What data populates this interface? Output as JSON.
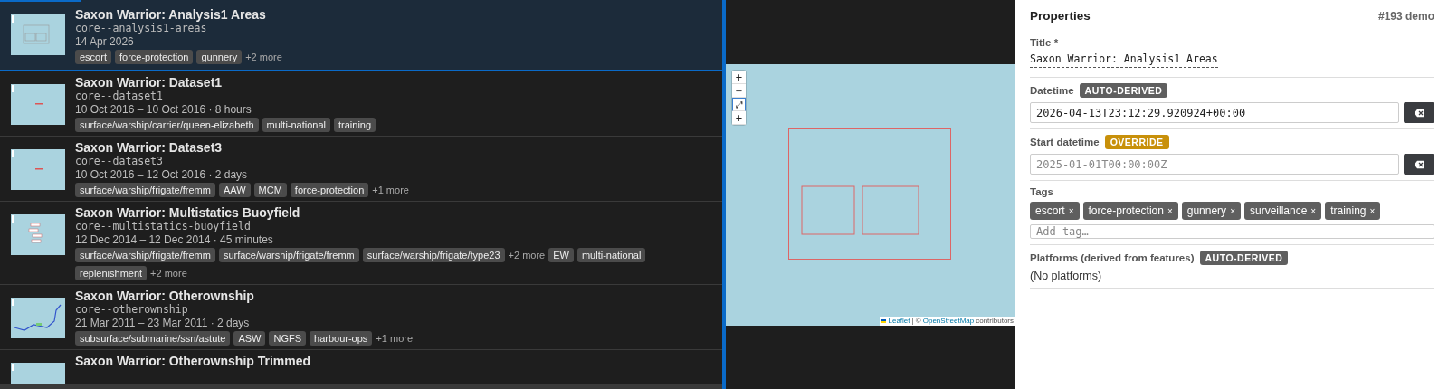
{
  "datasets": [
    {
      "title": "Saxon Warrior: Analysis1 Areas",
      "slug": "core--analysis1-areas",
      "date": "14 Apr 2026",
      "selected": true,
      "tags": [
        {
          "kind": "tag",
          "label": "escort"
        },
        {
          "kind": "tag",
          "label": "force-protection"
        },
        {
          "kind": "tag",
          "label": "gunnery"
        },
        {
          "kind": "more",
          "label": "+2 more"
        }
      ]
    },
    {
      "title": "Saxon Warrior: Dataset1",
      "slug": "core--dataset1",
      "date": "10 Oct 2016 – 10 Oct 2016 · 8 hours",
      "selected": false,
      "tags": [
        {
          "kind": "tag",
          "label": "surface/warship/carrier/queen-elizabeth"
        },
        {
          "kind": "tag",
          "label": "multi-national"
        },
        {
          "kind": "tag",
          "label": "training"
        }
      ]
    },
    {
      "title": "Saxon Warrior: Dataset3",
      "slug": "core--dataset3",
      "date": "10 Oct 2016 – 12 Oct 2016 · 2 days",
      "selected": false,
      "tags": [
        {
          "kind": "tag",
          "label": "surface/warship/frigate/fremm"
        },
        {
          "kind": "tag",
          "label": "AAW"
        },
        {
          "kind": "tag",
          "label": "MCM"
        },
        {
          "kind": "tag",
          "label": "force-protection"
        },
        {
          "kind": "more",
          "label": "+1 more"
        }
      ]
    },
    {
      "title": "Saxon Warrior: Multistatics Buoyfield",
      "slug": "core--multistatics-buoyfield",
      "date": "12 Dec 2014 – 12 Dec 2014 · 45 minutes",
      "selected": false,
      "tags": [
        {
          "kind": "tag",
          "label": "surface/warship/frigate/fremm"
        },
        {
          "kind": "tag",
          "label": "surface/warship/frigate/fremm"
        },
        {
          "kind": "tag",
          "label": "surface/warship/frigate/type23"
        },
        {
          "kind": "more",
          "label": "+2 more"
        },
        {
          "kind": "tag",
          "label": "EW"
        },
        {
          "kind": "tag",
          "label": "multi-national"
        },
        {
          "kind": "tag",
          "label": "replenishment"
        },
        {
          "kind": "more",
          "label": "+2 more"
        }
      ]
    },
    {
      "title": "Saxon Warrior: Otherownship",
      "slug": "core--otherownship",
      "date": "21 Mar 2011 – 23 Mar 2011 · 2 days",
      "selected": false,
      "tags": [
        {
          "kind": "tag",
          "label": "subsurface/submarine/ssn/astute"
        },
        {
          "kind": "tag",
          "label": "ASW"
        },
        {
          "kind": "tag",
          "label": "NGFS"
        },
        {
          "kind": "tag",
          "label": "harbour-ops"
        },
        {
          "kind": "more",
          "label": "+1 more"
        }
      ]
    },
    {
      "title": "Saxon Warrior: Otherownship Trimmed",
      "selected": false
    }
  ],
  "map": {
    "controls": [
      "+",
      "−",
      "⤢",
      "+"
    ],
    "attribution": {
      "link1": "Leaflet",
      "separator": "| ©",
      "link2": "OpenStreetMap",
      "rest": "contributors"
    }
  },
  "properties": {
    "heading": "Properties",
    "id": "#193 demo",
    "title_field": {
      "label": "Title *",
      "value": "Saxon Warrior: Analysis1 Areas"
    },
    "fields": [
      {
        "label": "Datetime",
        "badge": {
          "kind": "auto",
          "text": "AUTO-DERIVED"
        },
        "value": "2026-04-13T23:12:29.920924+00:00"
      },
      {
        "label": "Start datetime",
        "badge": {
          "kind": "override",
          "text": "OVERRIDE"
        },
        "placeholder": "2025-01-01T00:00:00Z"
      }
    ],
    "tags": {
      "label": "Tags",
      "items": [
        "escort",
        "force-protection",
        "gunnery",
        "surveillance",
        "training"
      ],
      "remove": "×",
      "placeholder": "Add tag…"
    },
    "platforms": {
      "label": "Platforms (derived from features)",
      "badge": {
        "kind": "auto",
        "text": "AUTO-DERIVED"
      },
      "value": "(No platforms)"
    }
  }
}
